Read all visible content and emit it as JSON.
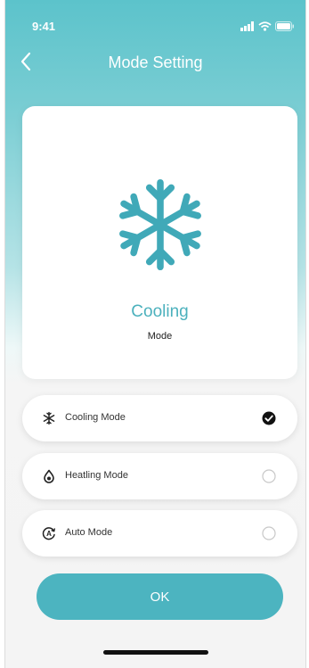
{
  "status_bar": {
    "time": "9:41"
  },
  "header": {
    "title": "Mode Setting"
  },
  "current_mode": {
    "name": "Cooling",
    "subtitle": "Mode"
  },
  "options": [
    {
      "label": "Cooling Mode",
      "icon": "snowflake-icon",
      "selected": true
    },
    {
      "label": "Heatling Mode",
      "icon": "drop-icon",
      "selected": false
    },
    {
      "label": "Auto Mode",
      "icon": "auto-icon",
      "selected": false
    }
  ],
  "ok_button": {
    "label": "OK"
  },
  "colors": {
    "accent": "#4cb4c0",
    "gradient_top": "#5cc3cb"
  }
}
